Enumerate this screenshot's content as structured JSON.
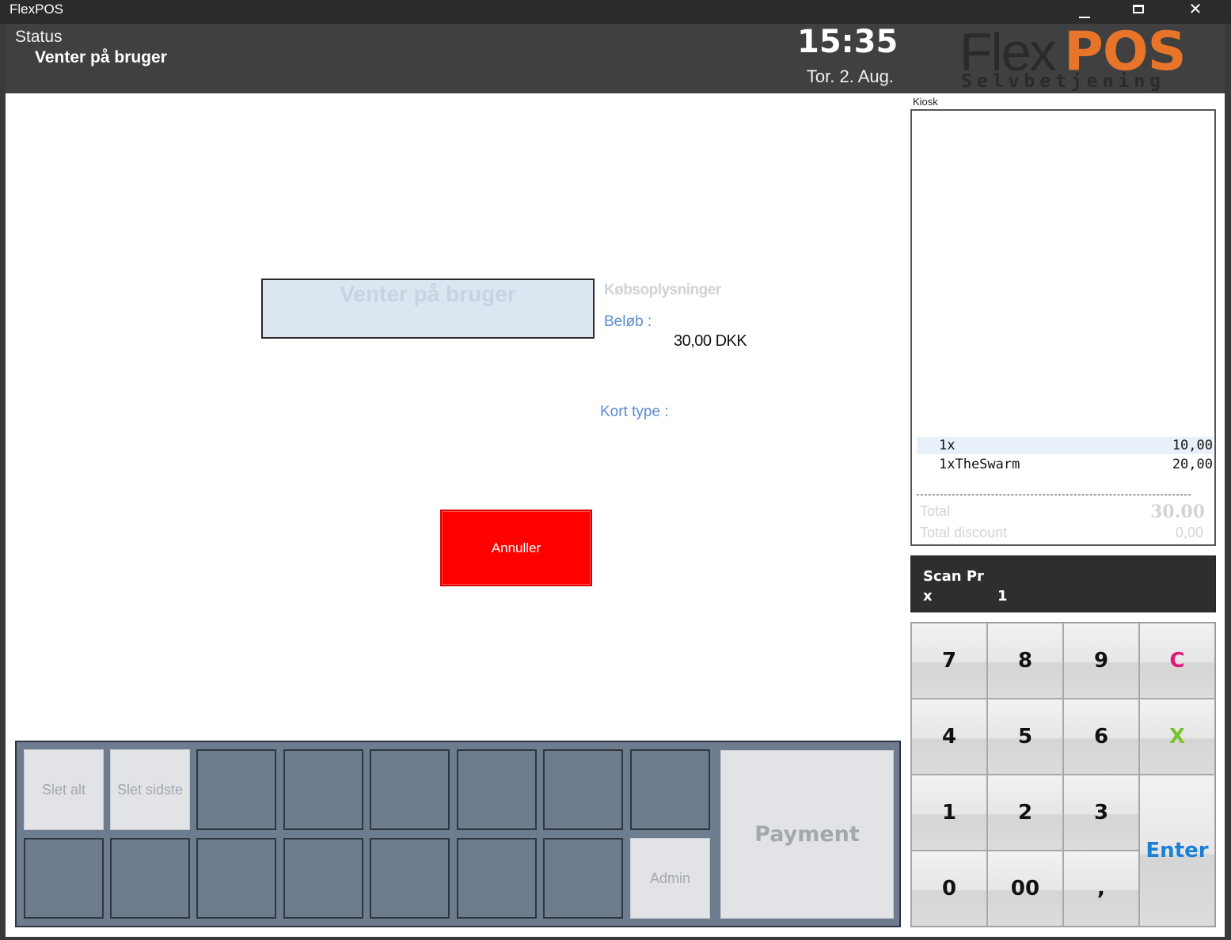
{
  "window": {
    "title": "FlexPOS",
    "minimize_icon": "minimize-icon",
    "maximize_icon": "maximize-icon",
    "close_icon": "close-icon",
    "close_glyph": "✕"
  },
  "header": {
    "status_label": "Status",
    "status_value": "Venter på bruger",
    "time": "15:35",
    "date": "Tor. 2. Aug.",
    "logo_flex": "Flex",
    "logo_pos": "POS",
    "logo_sub": "Selvbetjening",
    "logo_accent_color": "#e8742a"
  },
  "main": {
    "waiting_text": "Venter på bruger",
    "purchase_heading": "Købsoplysninger",
    "amount_label": "Beløb :",
    "amount_value": "30,00 DKK",
    "card_type_label": "Kort type :",
    "cancel_label": "Annuller",
    "cancel_color": "#ff0000"
  },
  "receipt": {
    "title": "Kiosk",
    "lines": [
      {
        "qty": "1x",
        "price": "10,00"
      },
      {
        "qty": "1xTheSwarm",
        "price": "20,00"
      }
    ],
    "total_label": "Total",
    "total_value": "30.00",
    "discount_label": "Total discount",
    "discount_value": "0,00"
  },
  "scan": {
    "title": "Scan Pr",
    "x_label": "x",
    "count": "1"
  },
  "keypad": {
    "k7": "7",
    "k8": "8",
    "k9": "9",
    "clear": "C",
    "k4": "4",
    "k5": "5",
    "k6": "6",
    "cancel": "X",
    "k1": "1",
    "k2": "2",
    "k3": "3",
    "enter": "Enter",
    "k0": "0",
    "k00": "00",
    "comma": ",",
    "clear_color": "#e3177a",
    "cancel_color": "#7ac231",
    "enter_color": "#1a7fd6"
  },
  "function_bar": {
    "delete_all": "Slet alt",
    "delete_last": "Slet sidste",
    "admin": "Admin",
    "payment": "Payment"
  }
}
